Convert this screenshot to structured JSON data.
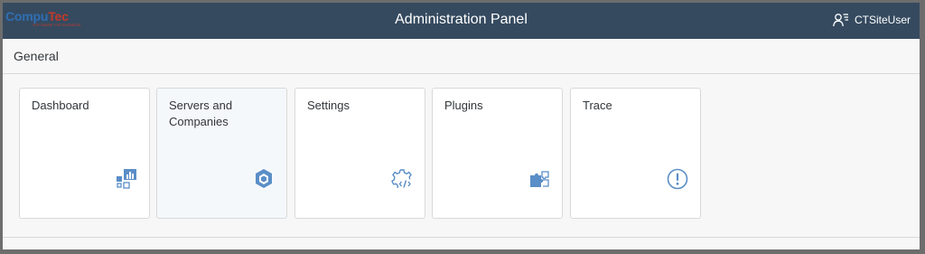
{
  "brand": {
    "logo_primary": "Compu",
    "logo_secondary": "Tec",
    "tagline": "SOFTWARE FOR BUSINESS"
  },
  "header": {
    "title": "Administration Panel",
    "user": "CTSiteUser"
  },
  "section": {
    "title": "General"
  },
  "tiles": [
    {
      "label": "Dashboard",
      "icon": "dashboard-icon"
    },
    {
      "label": "Servers and Companies",
      "icon": "cube-icon"
    },
    {
      "label": "Settings",
      "icon": "settings-code-icon"
    },
    {
      "label": "Plugins",
      "icon": "puzzle-icon"
    },
    {
      "label": "Trace",
      "icon": "exclamation-circle-icon"
    }
  ],
  "colors": {
    "shell": "#354a5f",
    "icon": "#5a8ec7",
    "tile_border": "#d9d9d9"
  }
}
